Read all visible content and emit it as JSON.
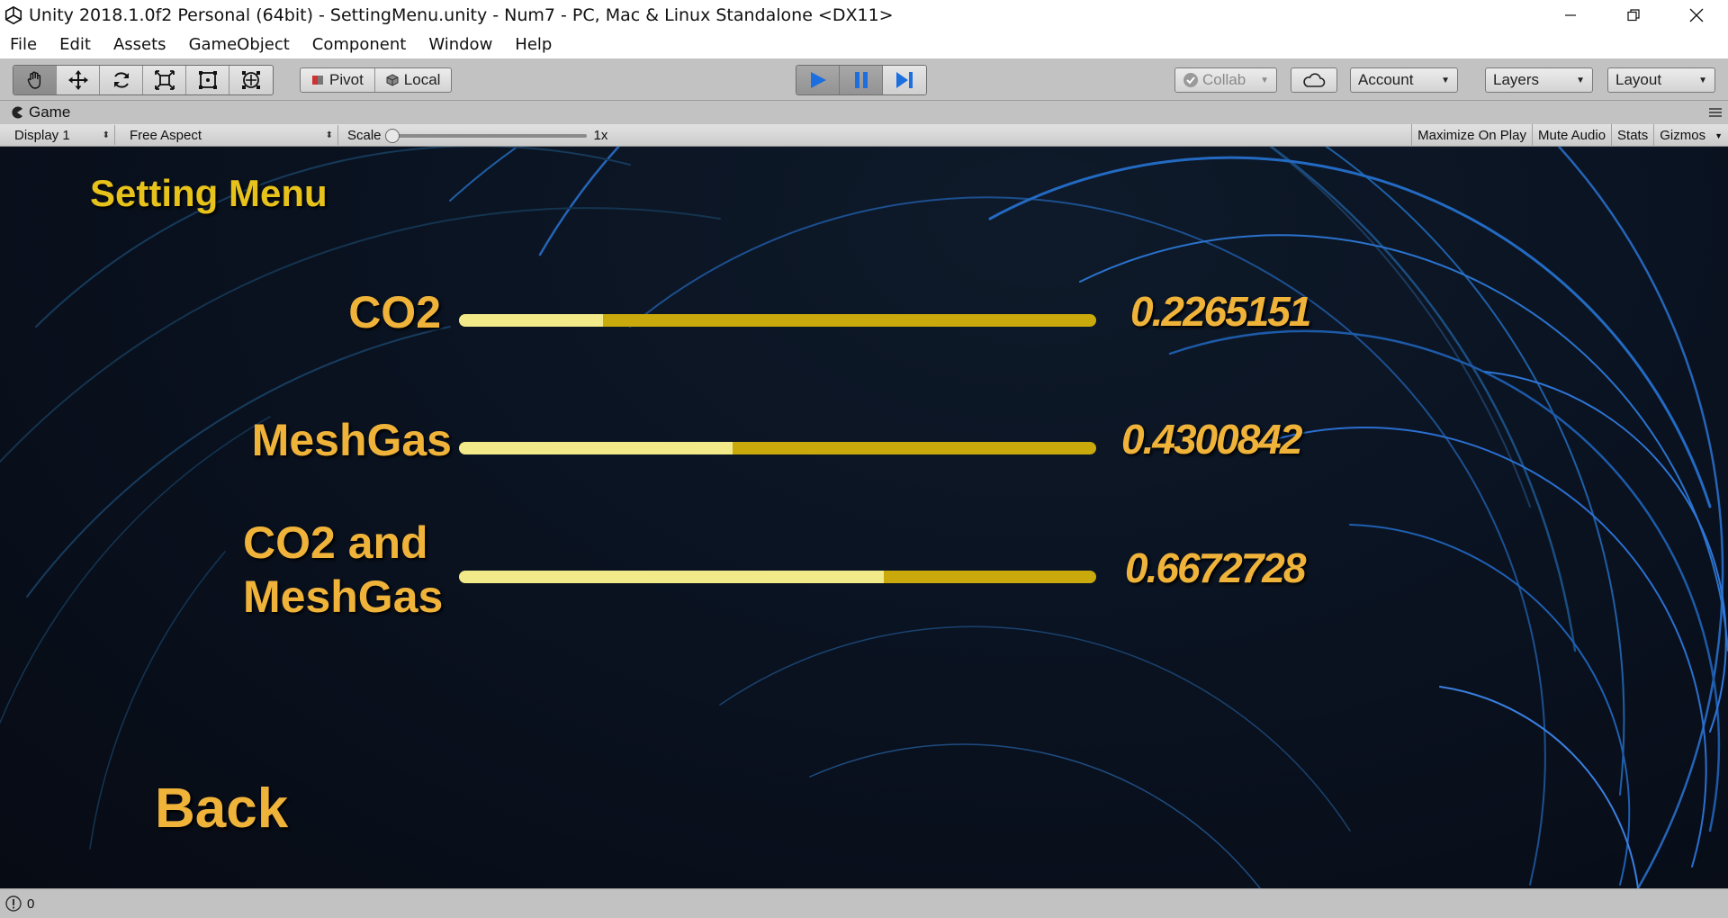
{
  "window": {
    "title": "Unity 2018.1.0f2 Personal (64bit) - SettingMenu.unity - Num7 - PC, Mac & Linux Standalone <DX11>"
  },
  "menubar": {
    "items": [
      {
        "label": "File"
      },
      {
        "label": "Edit"
      },
      {
        "label": "Assets"
      },
      {
        "label": "GameObject"
      },
      {
        "label": "Component"
      },
      {
        "label": "Window"
      },
      {
        "label": "Help"
      }
    ]
  },
  "toolbar": {
    "transform_tools": [
      "hand-tool",
      "move-tool",
      "rotate-tool",
      "scale-tool",
      "rect-tool",
      "transform-tool"
    ],
    "pivot_label": "Pivot",
    "local_label": "Local",
    "collab_label": "Collab",
    "account_label": "Account",
    "layers_label": "Layers",
    "layout_label": "Layout"
  },
  "game_tab": {
    "label": "Game"
  },
  "game_toolbar": {
    "display": "Display 1",
    "aspect": "Free Aspect",
    "scale_label": "Scale",
    "scale_value": "1x",
    "maximize_on_play": "Maximize On Play",
    "mute_audio": "Mute Audio",
    "stats": "Stats",
    "gizmos": "Gizmos"
  },
  "game": {
    "title": "Setting Menu",
    "sliders": [
      {
        "label": "CO2",
        "value": 0.2265151,
        "value_text": "0.2265151"
      },
      {
        "label": "MeshGas",
        "value": 0.4300842,
        "value_text": "0.4300842"
      },
      {
        "label_line1": "CO2 and",
        "label_line2": "MeshGas",
        "value": 0.6672728,
        "value_text": "0.6672728"
      }
    ],
    "back_label": "Back",
    "colors": {
      "title": "#e6c21b",
      "label": "#f0b33a",
      "bar_track": "#c9a90b",
      "bar_fill": "#f2ea88"
    }
  },
  "statusbar": {
    "count": "0"
  }
}
